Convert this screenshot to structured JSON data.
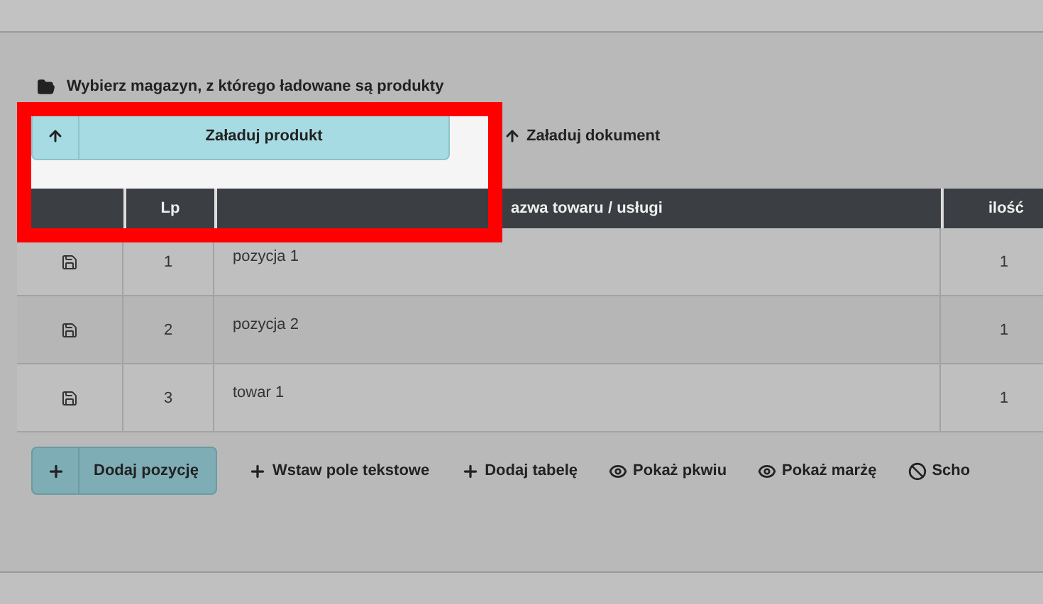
{
  "warehouse_link": "Wybierz magazyn, z którego ładowane są produkty",
  "upload": {
    "primary": "Załaduj produkt",
    "secondary": "Załaduj dokument"
  },
  "table": {
    "columns": [
      {},
      {
        "label": "Lp"
      },
      {
        "label": "azwa towaru / usługi"
      },
      {
        "label": "ilość"
      }
    ],
    "rows": [
      {
        "lp": "1",
        "name": "pozycja 1",
        "qty": "1"
      },
      {
        "lp": "2",
        "name": "pozycja 2",
        "qty": "1"
      },
      {
        "lp": "3",
        "name": "towar 1",
        "qty": "1"
      }
    ]
  },
  "actions": [
    {
      "kind": "button",
      "label": "Dodaj pozycję"
    },
    {
      "kind": "plus",
      "label": "Wstaw pole tekstowe"
    },
    {
      "kind": "plus",
      "label": "Dodaj tabelę"
    },
    {
      "kind": "eye",
      "label": "Pokaż pkwiu"
    },
    {
      "kind": "eye",
      "label": "Pokaż marżę"
    },
    {
      "kind": "ban",
      "label": "Scho"
    }
  ]
}
